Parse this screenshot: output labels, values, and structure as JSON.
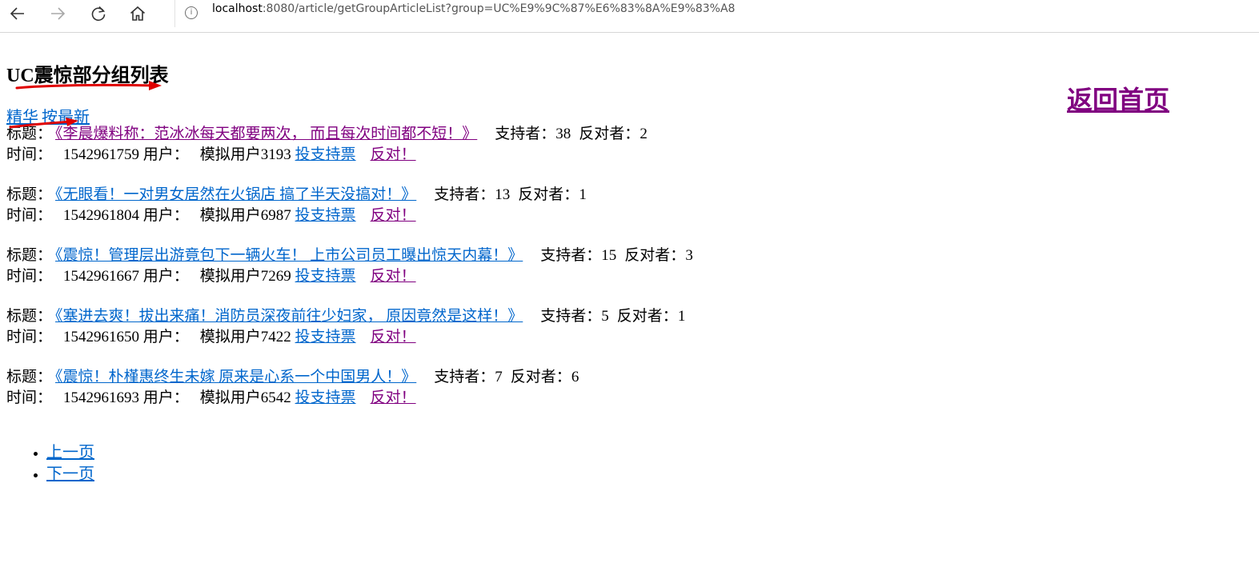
{
  "browser": {
    "address": {
      "host": "localhost",
      "path": ":8080/article/getGroupArticleList?group=UC%E9%9C%87%E6%83%8A%E9%83%A8",
      "info_icon": "i"
    },
    "icons": {
      "back": "back-arrow-icon",
      "forward": "forward-arrow-icon",
      "refresh": "refresh-icon",
      "home": "home-icon",
      "info": "info-icon"
    }
  },
  "page": {
    "title": "UC震惊部分组列表",
    "home_link": "返回首页",
    "tabs": [
      {
        "label": "精华"
      },
      {
        "label": "按最新"
      }
    ],
    "labels": {
      "title": "标题：",
      "time": "时间：",
      "user": "用户：",
      "supporters": "支持者：",
      "opponents": "反对者：",
      "vote_up": "投支持票",
      "vote_down": "反对！"
    },
    "articles": [
      {
        "title": "《李晨爆料称：范冰冰每天都要两次， 而且每次时间都不短！》",
        "supporters": "38",
        "opponents": "2",
        "time": "1542961759",
        "user": "模拟用户3193"
      },
      {
        "title": "《无眼看！一对男女居然在火锅店 搞了半天没搞对！》",
        "supporters": "13",
        "opponents": "1",
        "time": "1542961804",
        "user": "模拟用户6987"
      },
      {
        "title": "《震惊！管理层出游竟包下一辆火车！ 上市公司员工曝出惊天内幕！》",
        "supporters": "15",
        "opponents": "3",
        "time": "1542961667",
        "user": "模拟用户7269"
      },
      {
        "title": "《塞进去爽！拔出来痛！消防员深夜前往少妇家， 原因竟然是这样！》",
        "supporters": "5",
        "opponents": "1",
        "time": "1542961650",
        "user": "模拟用户7422"
      },
      {
        "title": "《震惊！朴槿惠终生未嫁 原来是心系一个中国男人！》",
        "supporters": "7",
        "opponents": "6",
        "time": "1542961693",
        "user": "模拟用户6542"
      }
    ],
    "pager": {
      "prev": "上一页",
      "next": "下一页"
    }
  },
  "colors": {
    "link": "#0066cc",
    "visited_link": "#800080",
    "annotation": "#e00000"
  }
}
